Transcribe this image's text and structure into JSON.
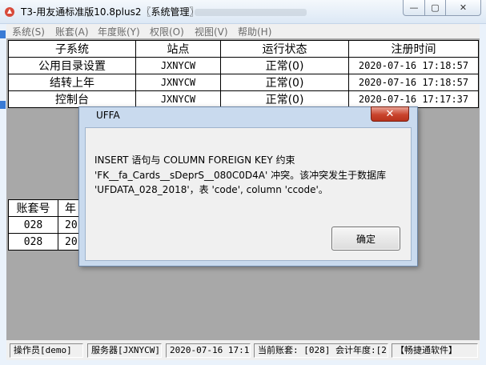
{
  "window": {
    "title": "T3-用友通标准版10.8plus2〖系统管理〗",
    "controls": [
      "minimize",
      "maximize",
      "close"
    ],
    "icon": "app-icon"
  },
  "menu": [
    "系统(S)",
    "账套(A)",
    "年度账(Y)",
    "权限(O)",
    "视图(V)",
    "帮助(H)"
  ],
  "subsystems": {
    "headers": [
      "子系统",
      "站点",
      "运行状态",
      "注册时间"
    ],
    "rows": [
      [
        "公用目录设置",
        "JXNYCW",
        "正常(0)",
        "2020-07-16 17:18:57"
      ],
      [
        "结转上年",
        "JXNYCW",
        "正常(0)",
        "2020-07-16 17:18:57"
      ],
      [
        "控制台",
        "JXNYCW",
        "正常(0)",
        "2020-07-16 17:17:37"
      ]
    ]
  },
  "accounts": {
    "headers": [
      "账套号",
      "年"
    ],
    "rows": [
      [
        "028",
        "20"
      ],
      [
        "028",
        "20"
      ]
    ]
  },
  "dialog": {
    "title": "UFFA",
    "lines": [
      "INSERT 语句与 COLUMN FOREIGN KEY 约束",
      "'FK__fa_Cards__sDeprS__080C0D4A' 冲突。该冲突发生于数据库",
      "'UFDATA_028_2018'，表 'code', column 'ccode'。"
    ],
    "ok_label": "确定",
    "close_label": "✕"
  },
  "status": [
    "操作员[demo]",
    "服务器[JXNYCW]",
    "2020-07-16 17:19",
    "当前账套: [028] 会计年度:[2",
    "【畅捷通软件】"
  ]
}
